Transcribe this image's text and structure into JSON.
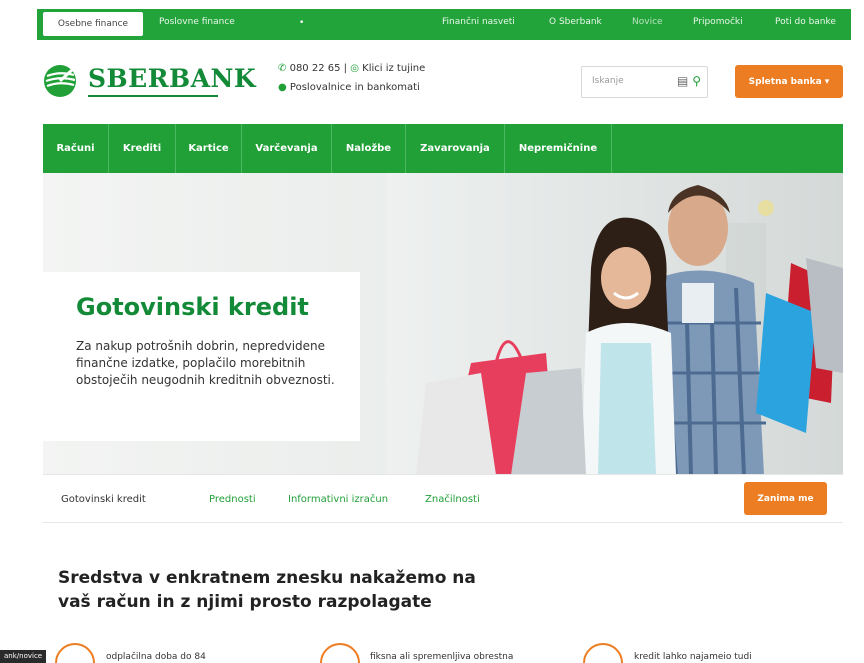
{
  "topbar": {
    "active_tab": "Osebne finance",
    "items": [
      "Poslovne finance",
      "Finančni nasveti",
      "O Sberbank",
      "Novice",
      "Pripomočki",
      "Poti do banke"
    ],
    "dot": "•"
  },
  "header": {
    "logo": "SBERBANK",
    "phone": "080 22 65",
    "abroad": "Klici iz tujine",
    "branches": "Poslovalnice in bankomati",
    "search_placeholder": "Iskanje",
    "online_bank": "Spletna banka ▾"
  },
  "nav": [
    "Računi",
    "Krediti",
    "Kartice",
    "Varčevanja",
    "Naložbe",
    "Zavarovanja",
    "Nepremičnine"
  ],
  "hero": {
    "title": "Gotovinski kredit",
    "description": "Za nakup potrošnih dobrin, nepredvidene finančne izdatke, poplačilo morebitnih obstoječih neugodnih kreditnih obveznosti."
  },
  "subnav": {
    "current": "Gotovinski kredit",
    "links": [
      "Prednosti",
      "Informativni izračun",
      "Značilnosti"
    ],
    "cta": "Zanima me"
  },
  "section": {
    "title": "Sredstva v enkratnem znesku nakažemo na vaš račun in z njimi prosto razpolagate",
    "features": [
      "odplačilna doba do 84",
      "fiksna ali spremenljiva obrestna",
      "kredit lahko najameio tudi"
    ]
  },
  "status_tooltip": "ank/novice",
  "colors": {
    "green": "#21a038",
    "dark_green": "#138a37",
    "orange": "#ec7d22"
  }
}
